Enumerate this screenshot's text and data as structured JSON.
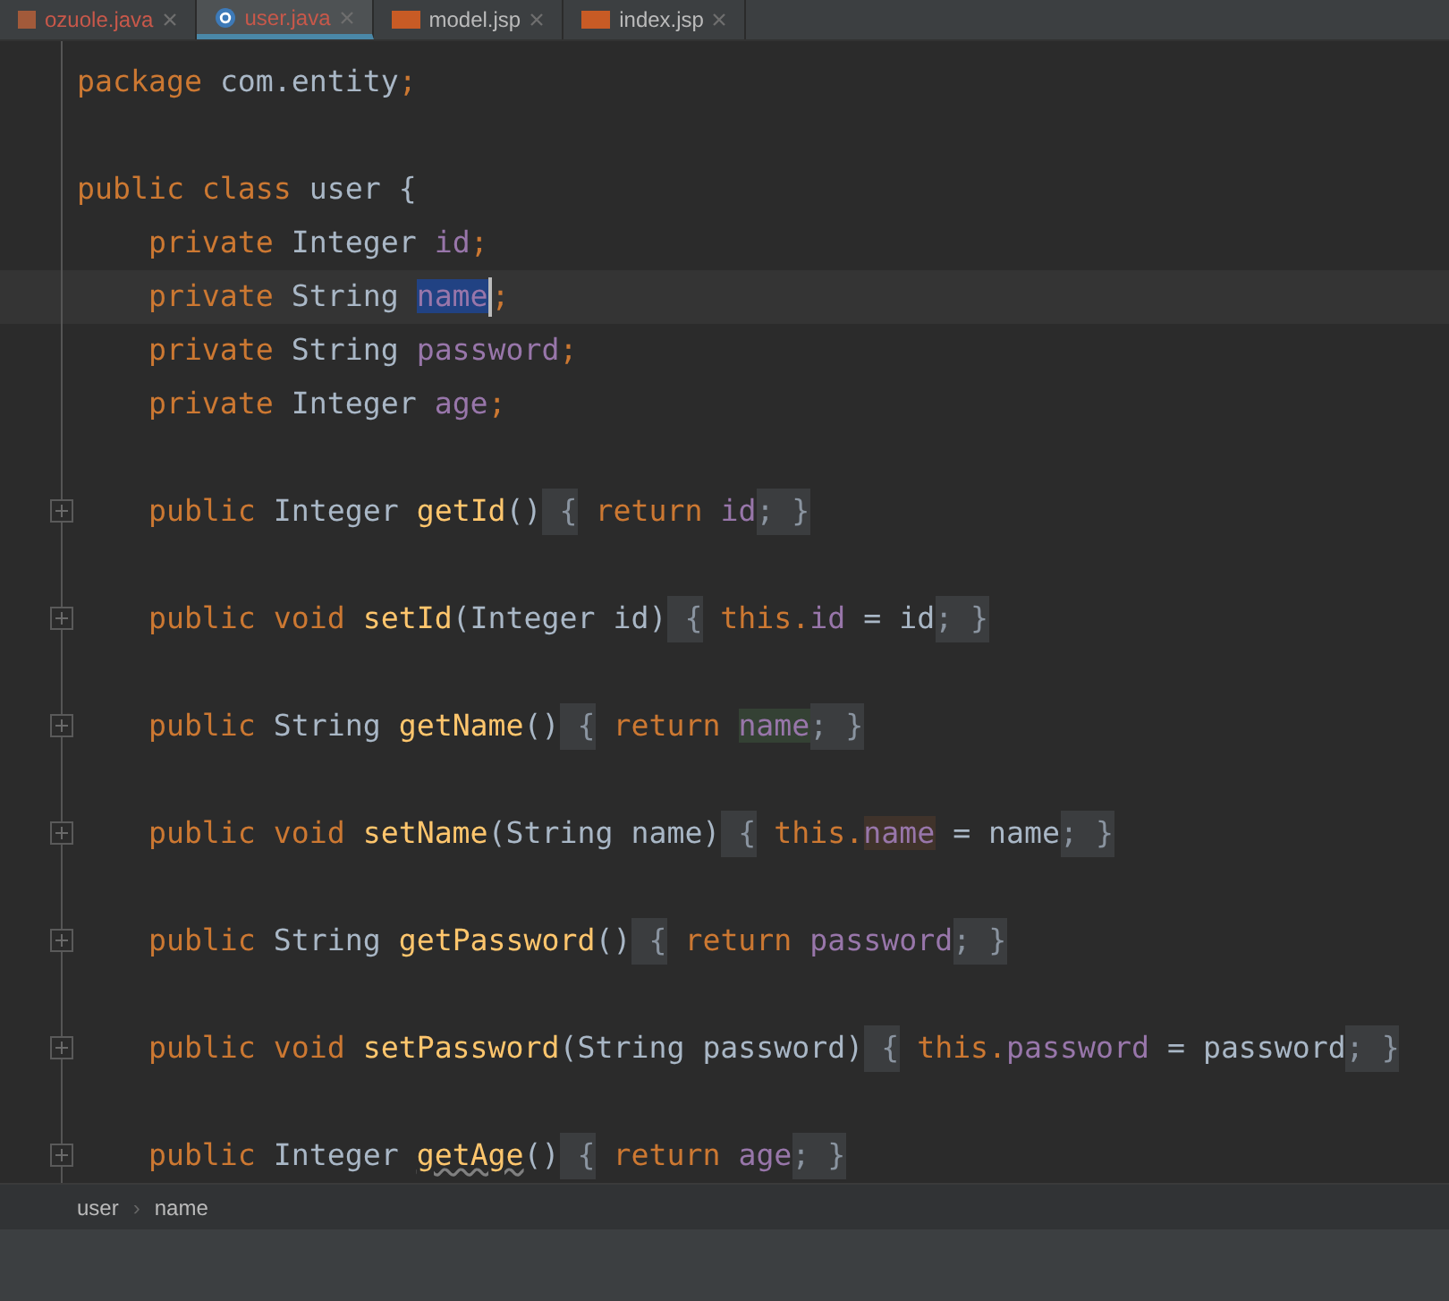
{
  "tabs": [
    {
      "label": "ozuole.java",
      "kind": "java",
      "selected": false
    },
    {
      "label": "user.java",
      "kind": "class",
      "selected": true
    },
    {
      "label": "model.jsp",
      "kind": "jsp",
      "selected": false
    },
    {
      "label": "index.jsp",
      "kind": "jsp",
      "selected": false
    }
  ],
  "lines": [
    {
      "foldable": false,
      "tokens": [
        {
          "text": "package ",
          "kind": "kw"
        },
        {
          "text": "com.entity",
          "kind": "plain"
        },
        {
          "text": ";",
          "kind": "kw"
        }
      ]
    },
    {
      "foldable": false
    },
    {
      "foldable": false,
      "tokens": [
        {
          "text": "public class ",
          "kind": "kw"
        },
        {
          "text": "user ",
          "kind": "plain"
        },
        {
          "text": "{",
          "kind": "plain"
        }
      ]
    },
    {
      "foldable": false,
      "tokens": [
        {
          "text": "    private ",
          "kind": "kw"
        },
        {
          "text": "Integer ",
          "kind": "plain"
        },
        {
          "text": "id",
          "kind": "field"
        },
        {
          "text": ";",
          "kind": "kw"
        }
      ]
    },
    {
      "foldable": false,
      "tokens": [
        {
          "text": "    private ",
          "kind": "kw"
        },
        {
          "text": "String ",
          "kind": "plain"
        },
        {
          "text": "name",
          "kind": "field-selected",
          "caret": true
        },
        {
          "text": ";",
          "kind": "kw"
        }
      ]
    },
    {
      "foldable": false,
      "tokens": [
        {
          "text": "    private ",
          "kind": "kw"
        },
        {
          "text": "String ",
          "kind": "plain"
        },
        {
          "text": "password",
          "kind": "field"
        },
        {
          "text": ";",
          "kind": "kw"
        }
      ]
    },
    {
      "foldable": false,
      "tokens": [
        {
          "text": "    private ",
          "kind": "kw"
        },
        {
          "text": "Integer ",
          "kind": "plain"
        },
        {
          "text": "age",
          "kind": "field"
        },
        {
          "text": ";",
          "kind": "kw"
        }
      ]
    },
    {
      "foldable": false
    },
    {
      "foldable": true,
      "tokens": [
        {
          "text": "    public ",
          "kind": "kw"
        },
        {
          "text": "Integer ",
          "kind": "plain"
        },
        {
          "text": "getId",
          "kind": "method"
        },
        {
          "text": "()",
          "kind": "plain"
        },
        {
          "text": " {",
          "kind": "fold"
        },
        {
          "text": " return ",
          "kind": "kw"
        },
        {
          "text": "id",
          "kind": "field"
        },
        {
          "text": "; }",
          "kind": "fold"
        }
      ]
    },
    {
      "foldable": false
    },
    {
      "foldable": true,
      "tokens": [
        {
          "text": "    public void ",
          "kind": "kw"
        },
        {
          "text": "setId",
          "kind": "method"
        },
        {
          "text": "(Integer id)",
          "kind": "plain"
        },
        {
          "text": " {",
          "kind": "fold"
        },
        {
          "text": " this.",
          "kind": "kw"
        },
        {
          "text": "id",
          "kind": "field"
        },
        {
          "text": " = id",
          "kind": "plain"
        },
        {
          "text": "; }",
          "kind": "fold"
        }
      ]
    },
    {
      "foldable": false
    },
    {
      "foldable": true,
      "tokens": [
        {
          "text": "    public ",
          "kind": "kw"
        },
        {
          "text": "String ",
          "kind": "plain"
        },
        {
          "text": "getName",
          "kind": "method"
        },
        {
          "text": "()",
          "kind": "plain"
        },
        {
          "text": " {",
          "kind": "fold"
        },
        {
          "text": " return ",
          "kind": "kw"
        },
        {
          "text": "name",
          "kind": "field-read"
        },
        {
          "text": "; }",
          "kind": "fold"
        }
      ]
    },
    {
      "foldable": false
    },
    {
      "foldable": true,
      "tokens": [
        {
          "text": "    public void ",
          "kind": "kw"
        },
        {
          "text": "setName",
          "kind": "method"
        },
        {
          "text": "(String name)",
          "kind": "plain"
        },
        {
          "text": " {",
          "kind": "fold"
        },
        {
          "text": " this.",
          "kind": "kw"
        },
        {
          "text": "name",
          "kind": "field-written"
        },
        {
          "text": " = name",
          "kind": "plain"
        },
        {
          "text": "; }",
          "kind": "fold"
        }
      ]
    },
    {
      "foldable": false
    },
    {
      "foldable": true,
      "tokens": [
        {
          "text": "    public ",
          "kind": "kw"
        },
        {
          "text": "String ",
          "kind": "plain"
        },
        {
          "text": "getPassword",
          "kind": "method"
        },
        {
          "text": "()",
          "kind": "plain"
        },
        {
          "text": " {",
          "kind": "fold"
        },
        {
          "text": " return ",
          "kind": "kw"
        },
        {
          "text": "password",
          "kind": "field"
        },
        {
          "text": "; }",
          "kind": "fold"
        }
      ]
    },
    {
      "foldable": false
    },
    {
      "foldable": true,
      "tokens": [
        {
          "text": "    public void ",
          "kind": "kw"
        },
        {
          "text": "setPassword",
          "kind": "method"
        },
        {
          "text": "(String password)",
          "kind": "plain"
        },
        {
          "text": " {",
          "kind": "fold"
        },
        {
          "text": " this.",
          "kind": "kw"
        },
        {
          "text": "password",
          "kind": "field"
        },
        {
          "text": " = password",
          "kind": "plain"
        },
        {
          "text": "; }",
          "kind": "fold"
        }
      ]
    },
    {
      "foldable": false
    },
    {
      "foldable": true,
      "tokens": [
        {
          "text": "    public ",
          "kind": "kw"
        },
        {
          "text": "Integer ",
          "kind": "plain"
        },
        {
          "text": "getAge",
          "kind": "method-typo"
        },
        {
          "text": "()",
          "kind": "plain"
        },
        {
          "text": " {",
          "kind": "fold"
        },
        {
          "text": " return ",
          "kind": "kw"
        },
        {
          "text": "age",
          "kind": "field"
        },
        {
          "text": "; }",
          "kind": "fold"
        }
      ]
    }
  ],
  "breadcrumbs": [
    {
      "label": "user",
      "separator": "›"
    },
    {
      "label": "name"
    }
  ]
}
